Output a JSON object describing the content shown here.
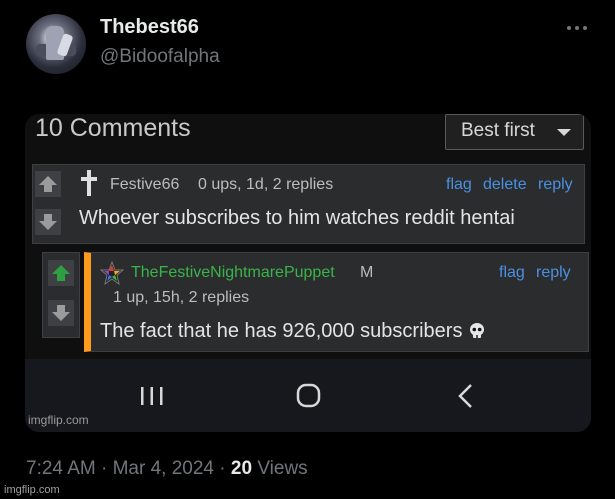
{
  "tweet": {
    "display_name": "Thebest66",
    "handle": "@Bidoofalpha",
    "time": "7:24 AM",
    "separator1": "·",
    "date": "Mar 4, 2024",
    "separator2": "·",
    "views_count": "20",
    "views_label": "Views",
    "more_icon": "more-horizontal-icon"
  },
  "screenshot": {
    "comments_title": "10 Comments",
    "sort_label": "Best first",
    "comments": [
      {
        "username": "Festive66",
        "meta": "0 ups, 1d, 2 replies",
        "actions": [
          "flag",
          "delete",
          "reply"
        ],
        "body": "Whoever subscribes to him watches reddit hentai",
        "icon": "cross-icon"
      },
      {
        "username": "TheFestiveNightmarePuppet",
        "badge": "M",
        "meta": "1 up, 15h, 2 replies",
        "actions": [
          "flag",
          "reply"
        ],
        "body": "The fact that he has 926,000 subscribers",
        "icon": "rainbow-star-icon",
        "emoji_icon": "skull-icon"
      }
    ],
    "watermark": "imgflip.com"
  },
  "footer_watermark": "imgflip.com",
  "colors": {
    "background": "#000000",
    "upvote_active": "#2ea043",
    "link": "#4a90e2",
    "username_green": "#39b548",
    "reply_accent": "#ff9b1a"
  }
}
